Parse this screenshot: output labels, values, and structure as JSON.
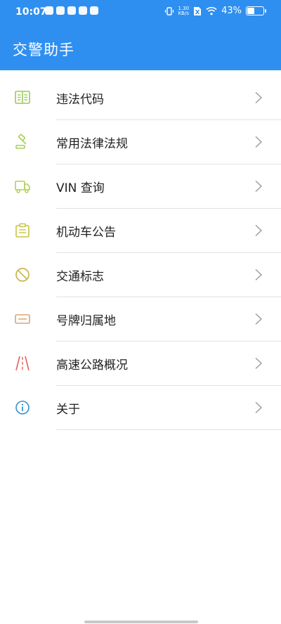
{
  "status_bar": {
    "time": "10:07",
    "net_speed_value": "1.30",
    "net_speed_unit": "KB/s",
    "battery_percent": "43%",
    "battery_level": 0.43
  },
  "header": {
    "title": "交警助手",
    "background_color": "#2f8ff0"
  },
  "menu": {
    "items": [
      {
        "label": "违法代码",
        "icon": "book-icon",
        "icon_color": "#9bc95a"
      },
      {
        "label": "常用法律法规",
        "icon": "gavel-icon",
        "icon_color": "#a6cf5c"
      },
      {
        "label": "VIN 查询",
        "icon": "truck-icon",
        "icon_color": "#b2cf54"
      },
      {
        "label": "机动车公告",
        "icon": "clipboard-icon",
        "icon_color": "#c8c442"
      },
      {
        "label": "交通标志",
        "icon": "prohibition-sign-icon",
        "icon_color": "#c9b54a"
      },
      {
        "label": "号牌归属地",
        "icon": "license-plate-icon",
        "icon_color": "#d9a572"
      },
      {
        "label": "高速公路概况",
        "icon": "highway-icon",
        "icon_color": "#e06a62"
      },
      {
        "label": "关于",
        "icon": "info-icon",
        "icon_color": "#3b8fcf"
      }
    ]
  }
}
